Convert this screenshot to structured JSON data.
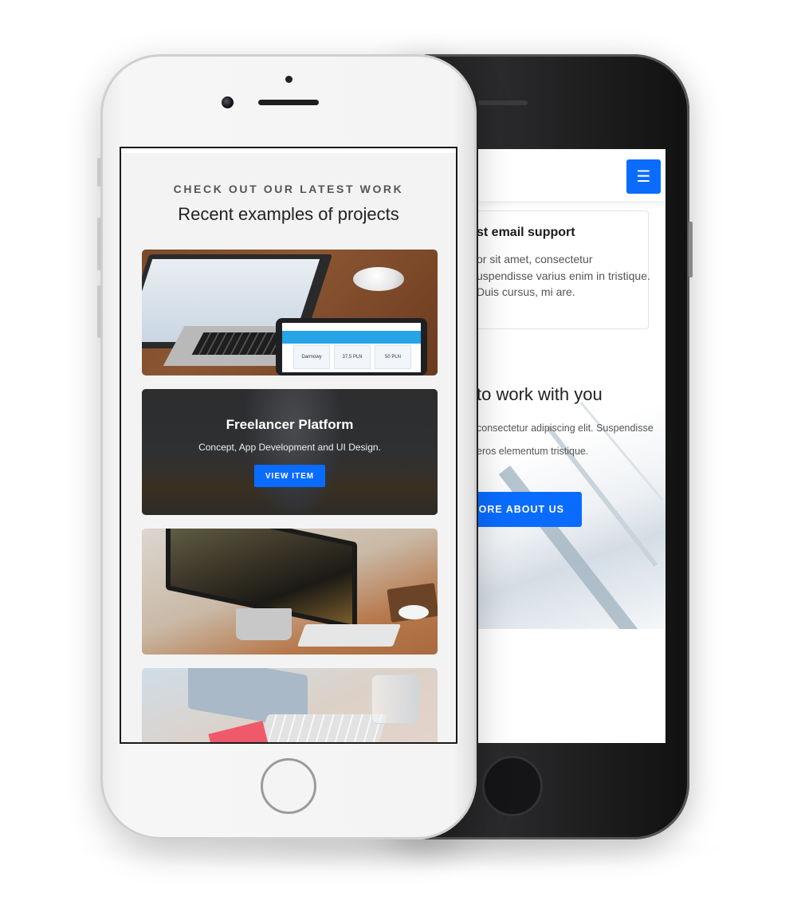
{
  "back_phone": {
    "menu_icon": "hamburger-icon",
    "feature": {
      "title": "st email support",
      "text": "or sit amet, consectetur uspendisse varius enim in tristique. Duis cursus, mi are."
    },
    "hero": {
      "title": "to work with you",
      "text": "consectetur adipiscing elit. Suspendisse eros elementum tristique."
    },
    "about_button": "MORE ABOUT US"
  },
  "front_phone": {
    "eyebrow": "CHECK OUT OUR LATEST WORK",
    "headline": "Recent examples of projects",
    "featured_card": {
      "title": "Freelancer Platform",
      "subtitle": "Concept, App Development and UI Design.",
      "button": "VIEW ITEM"
    },
    "tablet_prices": [
      "Darmowy",
      "37,5 PLN",
      "50 PLN"
    ]
  },
  "colors": {
    "accent": "#0a6cff",
    "screen_bg": "#f3f3f3"
  }
}
